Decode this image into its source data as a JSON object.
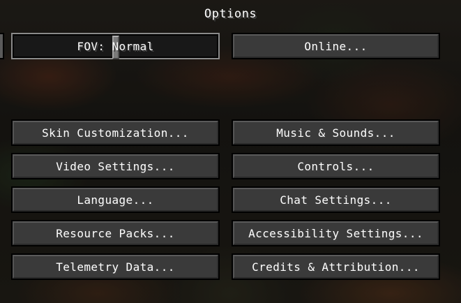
{
  "title": "Options",
  "fov_slider": {
    "label": "FOV: Normal",
    "value_fraction": 0.5
  },
  "online_button": "Online...",
  "buttons": [
    [
      "Skin Customization...",
      "Music & Sounds..."
    ],
    [
      "Video Settings...",
      "Controls..."
    ],
    [
      "Language...",
      "Chat Settings..."
    ],
    [
      "Resource Packs...",
      "Accessibility Settings..."
    ],
    [
      "Telemetry Data...",
      "Credits & Attribution..."
    ]
  ]
}
